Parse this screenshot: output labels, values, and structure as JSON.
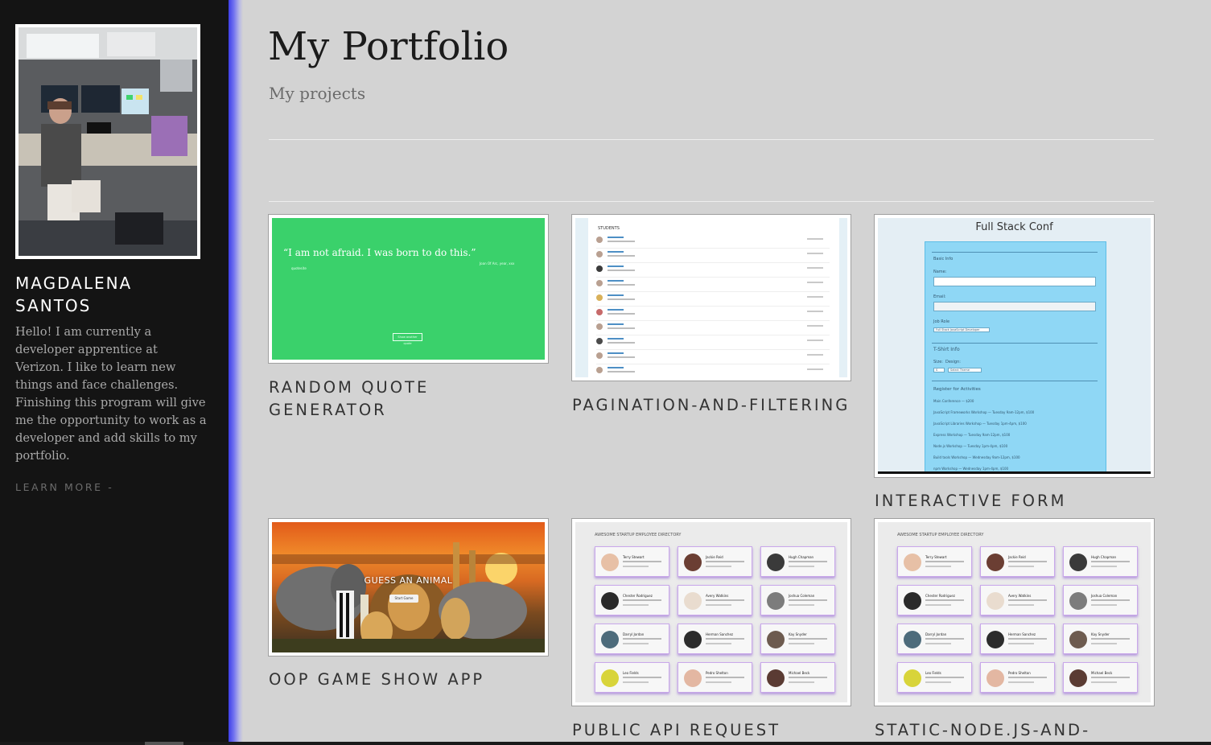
{
  "sidebar": {
    "name": "MAGDALENA SANTOS",
    "bio": "Hello! I am currently a developer apprentice at Verizon. I like to learn new things and face challenges. Finishing this program will give me the opportunity to work as a developer and add skills to my portfolio.",
    "learn_more": "LEARN MORE -"
  },
  "header": {
    "title": "My Portfolio",
    "subtitle": "My projects"
  },
  "projects": [
    {
      "title": "RANDOM QUOTE GENERATOR"
    },
    {
      "title": "PAGINATION-AND-FILTERING"
    },
    {
      "title": "INTERACTIVE FORM"
    },
    {
      "title": "OOP GAME SHOW APP"
    },
    {
      "title": "PUBLIC API REQUEST"
    },
    {
      "title": "STATIC-NODE.JS-AND-"
    }
  ],
  "thumbs": {
    "quote": {
      "text": "“I am not afraid. I was born to do this.”",
      "author": "Joan Of Arc, year, xxx",
      "source": "quotesite",
      "button": "Show another quote"
    },
    "pagination": {
      "heading": "STUDENTS"
    },
    "form": {
      "title": "Full Stack Conf",
      "basic_info": "Basic Info",
      "name_label": "Name:",
      "email_label": "Email:",
      "job_role_label": "Job Role",
      "job_role_value": "Full Stack JavaScript Developer",
      "tshirt_info": "T-Shirt Info",
      "size_label": "Size:",
      "design_label": "Design:",
      "size_value": "S",
      "design_value": "Select Theme",
      "activities_label": "Register for Activities",
      "activities": [
        "Main Conference — $200",
        "JavaScript Frameworks Workshop — Tuesday 9am-12pm, $100",
        "JavaScript Libraries Workshop — Tuesday 1pm-4pm, $100",
        "Express Workshop — Tuesday 9am-12pm, $100",
        "Node.js Workshop — Tuesday 1pm-4pm, $100",
        "Build tools Workshop — Wednesday 9am-12pm, $100",
        "npm Workshop — Wednesday 1pm-4pm, $100"
      ]
    },
    "game": {
      "title": "GUESS AN ANIMAL",
      "button": "Start Game"
    },
    "directory": {
      "heading": "AWESOME STARTUP EMPLOYEE DIRECTORY",
      "people": [
        "Terry Stewart",
        "Jackie Reid",
        "Hugh Chapman",
        "Chester Rodriguez",
        "Avery Watkins",
        "Joshua Coleman",
        "Darryl Jordan",
        "Herman Sanchez",
        "Kay Snyder",
        "Leo Fields",
        "Pedro Shelton",
        "Michael Beck"
      ]
    }
  },
  "colors": {
    "sidebar_bg": "#141414",
    "page_bg": "#d3d3d3",
    "accent_edge": "#3d3ee8",
    "quote_green": "#3ad16b",
    "form_blue": "#8fd7f5",
    "card_purple": "#c9a8ea"
  }
}
